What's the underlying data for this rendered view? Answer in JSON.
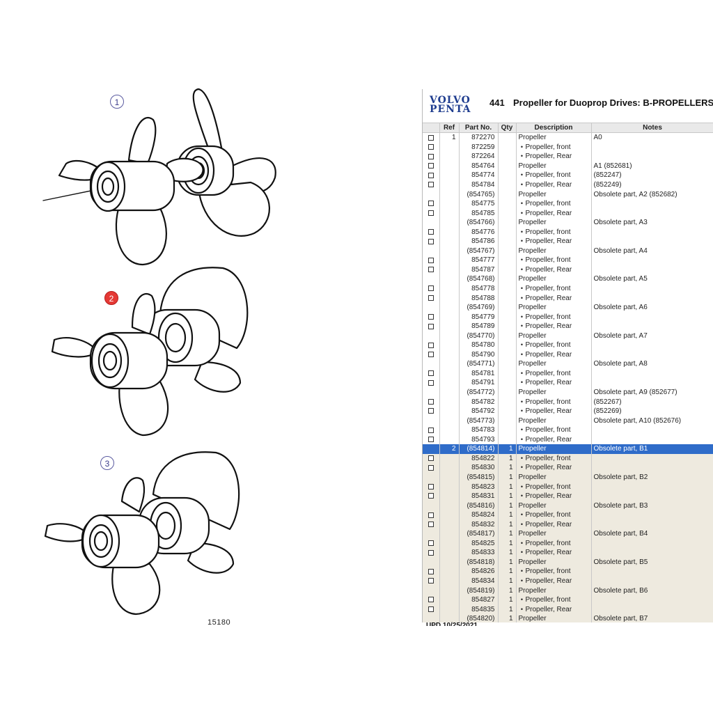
{
  "drawing": {
    "callouts": [
      "1",
      "2",
      "3"
    ],
    "figure_number": "15180"
  },
  "header": {
    "logo_line1": "VOLVO",
    "logo_line2": "PENTA",
    "section_number": "441",
    "section_title": "Propeller for Duoprop Drives: B-PROPELLERS"
  },
  "table": {
    "columns": [
      "",
      "Ref",
      "Part No.",
      "Qty",
      "Description",
      "Notes"
    ],
    "rows": [
      {
        "chk": true,
        "ref": "1",
        "part": "872270",
        "qty": "",
        "desc": "Propeller",
        "sub": false,
        "notes": "A0",
        "grp": 1
      },
      {
        "chk": true,
        "ref": "",
        "part": "872259",
        "qty": "",
        "desc": "Propeller, front",
        "sub": true,
        "notes": "",
        "grp": 1
      },
      {
        "chk": true,
        "ref": "",
        "part": "872264",
        "qty": "",
        "desc": "Propeller, Rear",
        "sub": true,
        "notes": "",
        "grp": 1
      },
      {
        "chk": true,
        "ref": "",
        "part": "854764",
        "qty": "",
        "desc": "Propeller",
        "sub": false,
        "notes": "A1 (852681)",
        "grp": 1
      },
      {
        "chk": true,
        "ref": "",
        "part": "854774",
        "qty": "",
        "desc": "Propeller, front",
        "sub": true,
        "notes": "(852247)",
        "grp": 1
      },
      {
        "chk": true,
        "ref": "",
        "part": "854784",
        "qty": "",
        "desc": "Propeller, Rear",
        "sub": true,
        "notes": "(852249)",
        "grp": 1
      },
      {
        "chk": false,
        "ref": "",
        "part": "(854765)",
        "qty": "",
        "desc": "Propeller",
        "sub": false,
        "notes": "Obsolete part, A2 (852682)",
        "grp": 1
      },
      {
        "chk": true,
        "ref": "",
        "part": "854775",
        "qty": "",
        "desc": "Propeller, front",
        "sub": true,
        "notes": "",
        "grp": 1
      },
      {
        "chk": true,
        "ref": "",
        "part": "854785",
        "qty": "",
        "desc": "Propeller, Rear",
        "sub": true,
        "notes": "",
        "grp": 1
      },
      {
        "chk": false,
        "ref": "",
        "part": "(854766)",
        "qty": "",
        "desc": "Propeller",
        "sub": false,
        "notes": "Obsolete part, A3",
        "grp": 1
      },
      {
        "chk": true,
        "ref": "",
        "part": "854776",
        "qty": "",
        "desc": "Propeller, front",
        "sub": true,
        "notes": "",
        "grp": 1
      },
      {
        "chk": true,
        "ref": "",
        "part": "854786",
        "qty": "",
        "desc": "Propeller, Rear",
        "sub": true,
        "notes": "",
        "grp": 1
      },
      {
        "chk": false,
        "ref": "",
        "part": "(854767)",
        "qty": "",
        "desc": "Propeller",
        "sub": false,
        "notes": "Obsolete part, A4",
        "grp": 1
      },
      {
        "chk": true,
        "ref": "",
        "part": "854777",
        "qty": "",
        "desc": "Propeller, front",
        "sub": true,
        "notes": "",
        "grp": 1
      },
      {
        "chk": true,
        "ref": "",
        "part": "854787",
        "qty": "",
        "desc": "Propeller, Rear",
        "sub": true,
        "notes": "",
        "grp": 1
      },
      {
        "chk": false,
        "ref": "",
        "part": "(854768)",
        "qty": "",
        "desc": "Propeller",
        "sub": false,
        "notes": "Obsolete part, A5",
        "grp": 1
      },
      {
        "chk": true,
        "ref": "",
        "part": "854778",
        "qty": "",
        "desc": "Propeller, front",
        "sub": true,
        "notes": "",
        "grp": 1
      },
      {
        "chk": true,
        "ref": "",
        "part": "854788",
        "qty": "",
        "desc": "Propeller, Rear",
        "sub": true,
        "notes": "",
        "grp": 1
      },
      {
        "chk": false,
        "ref": "",
        "part": "(854769)",
        "qty": "",
        "desc": "Propeller",
        "sub": false,
        "notes": "Obsolete part, A6",
        "grp": 1
      },
      {
        "chk": true,
        "ref": "",
        "part": "854779",
        "qty": "",
        "desc": "Propeller, front",
        "sub": true,
        "notes": "",
        "grp": 1
      },
      {
        "chk": true,
        "ref": "",
        "part": "854789",
        "qty": "",
        "desc": "Propeller, Rear",
        "sub": true,
        "notes": "",
        "grp": 1
      },
      {
        "chk": false,
        "ref": "",
        "part": "(854770)",
        "qty": "",
        "desc": "Propeller",
        "sub": false,
        "notes": "Obsolete part, A7",
        "grp": 1
      },
      {
        "chk": true,
        "ref": "",
        "part": "854780",
        "qty": "",
        "desc": "Propeller, front",
        "sub": true,
        "notes": "",
        "grp": 1
      },
      {
        "chk": true,
        "ref": "",
        "part": "854790",
        "qty": "",
        "desc": "Propeller, Rear",
        "sub": true,
        "notes": "",
        "grp": 1
      },
      {
        "chk": false,
        "ref": "",
        "part": "(854771)",
        "qty": "",
        "desc": "Propeller",
        "sub": false,
        "notes": "Obsolete part, A8",
        "grp": 1
      },
      {
        "chk": true,
        "ref": "",
        "part": "854781",
        "qty": "",
        "desc": "Propeller, front",
        "sub": true,
        "notes": "",
        "grp": 1
      },
      {
        "chk": true,
        "ref": "",
        "part": "854791",
        "qty": "",
        "desc": "Propeller, Rear",
        "sub": true,
        "notes": "",
        "grp": 1
      },
      {
        "chk": false,
        "ref": "",
        "part": "(854772)",
        "qty": "",
        "desc": "Propeller",
        "sub": false,
        "notes": "Obsolete part, A9 (852677)",
        "grp": 1
      },
      {
        "chk": true,
        "ref": "",
        "part": "854782",
        "qty": "",
        "desc": "Propeller, front",
        "sub": true,
        "notes": "(852267)",
        "grp": 1
      },
      {
        "chk": true,
        "ref": "",
        "part": "854792",
        "qty": "",
        "desc": "Propeller, Rear",
        "sub": true,
        "notes": "(852269)",
        "grp": 1
      },
      {
        "chk": false,
        "ref": "",
        "part": "(854773)",
        "qty": "",
        "desc": "Propeller",
        "sub": false,
        "notes": "Obsolete part, A10 (852676)",
        "grp": 1
      },
      {
        "chk": true,
        "ref": "",
        "part": "854783",
        "qty": "",
        "desc": "Propeller, front",
        "sub": true,
        "notes": "",
        "grp": 1
      },
      {
        "chk": true,
        "ref": "",
        "part": "854793",
        "qty": "",
        "desc": "Propeller, Rear",
        "sub": true,
        "notes": "",
        "grp": 1
      },
      {
        "chk": false,
        "ref": "2",
        "part": "(854814)",
        "qty": "1",
        "desc": "Propeller",
        "sub": false,
        "notes": "Obsolete part, B1",
        "grp": 2,
        "selected": true
      },
      {
        "chk": true,
        "ref": "",
        "part": "854822",
        "qty": "1",
        "desc": "Propeller, front",
        "sub": true,
        "notes": "",
        "grp": 2
      },
      {
        "chk": true,
        "ref": "",
        "part": "854830",
        "qty": "1",
        "desc": "Propeller, Rear",
        "sub": true,
        "notes": "",
        "grp": 2
      },
      {
        "chk": false,
        "ref": "",
        "part": "(854815)",
        "qty": "1",
        "desc": "Propeller",
        "sub": false,
        "notes": "Obsolete part, B2",
        "grp": 2
      },
      {
        "chk": true,
        "ref": "",
        "part": "854823",
        "qty": "1",
        "desc": "Propeller, front",
        "sub": true,
        "notes": "",
        "grp": 2
      },
      {
        "chk": true,
        "ref": "",
        "part": "854831",
        "qty": "1",
        "desc": "Propeller, Rear",
        "sub": true,
        "notes": "",
        "grp": 2
      },
      {
        "chk": false,
        "ref": "",
        "part": "(854816)",
        "qty": "1",
        "desc": "Propeller",
        "sub": false,
        "notes": "Obsolete part, B3",
        "grp": 2
      },
      {
        "chk": true,
        "ref": "",
        "part": "854824",
        "qty": "1",
        "desc": "Propeller, front",
        "sub": true,
        "notes": "",
        "grp": 2
      },
      {
        "chk": true,
        "ref": "",
        "part": "854832",
        "qty": "1",
        "desc": "Propeller, Rear",
        "sub": true,
        "notes": "",
        "grp": 2
      },
      {
        "chk": false,
        "ref": "",
        "part": "(854817)",
        "qty": "1",
        "desc": "Propeller",
        "sub": false,
        "notes": "Obsolete part, B4",
        "grp": 2
      },
      {
        "chk": true,
        "ref": "",
        "part": "854825",
        "qty": "1",
        "desc": "Propeller, front",
        "sub": true,
        "notes": "",
        "grp": 2
      },
      {
        "chk": true,
        "ref": "",
        "part": "854833",
        "qty": "1",
        "desc": "Propeller, Rear",
        "sub": true,
        "notes": "",
        "grp": 2
      },
      {
        "chk": false,
        "ref": "",
        "part": "(854818)",
        "qty": "1",
        "desc": "Propeller",
        "sub": false,
        "notes": "Obsolete part, B5",
        "grp": 2
      },
      {
        "chk": true,
        "ref": "",
        "part": "854826",
        "qty": "1",
        "desc": "Propeller, front",
        "sub": true,
        "notes": "",
        "grp": 2
      },
      {
        "chk": true,
        "ref": "",
        "part": "854834",
        "qty": "1",
        "desc": "Propeller, Rear",
        "sub": true,
        "notes": "",
        "grp": 2
      },
      {
        "chk": false,
        "ref": "",
        "part": "(854819)",
        "qty": "1",
        "desc": "Propeller",
        "sub": false,
        "notes": "Obsolete part, B6",
        "grp": 2
      },
      {
        "chk": true,
        "ref": "",
        "part": "854827",
        "qty": "1",
        "desc": "Propeller, front",
        "sub": true,
        "notes": "",
        "grp": 2
      },
      {
        "chk": true,
        "ref": "",
        "part": "854835",
        "qty": "1",
        "desc": "Propeller, Rear",
        "sub": true,
        "notes": "",
        "grp": 2
      },
      {
        "chk": false,
        "ref": "",
        "part": "(854820)",
        "qty": "1",
        "desc": "Propeller",
        "sub": false,
        "notes": "Obsolete part, B7",
        "grp": 2
      }
    ]
  },
  "footer": {
    "text": "UPD 10/25/2021"
  },
  "colors": {
    "selection": "#2f6cc9",
    "group_bg": "#eeeadf",
    "logo": "#1f3d8f",
    "active_callout": "#e53935"
  }
}
